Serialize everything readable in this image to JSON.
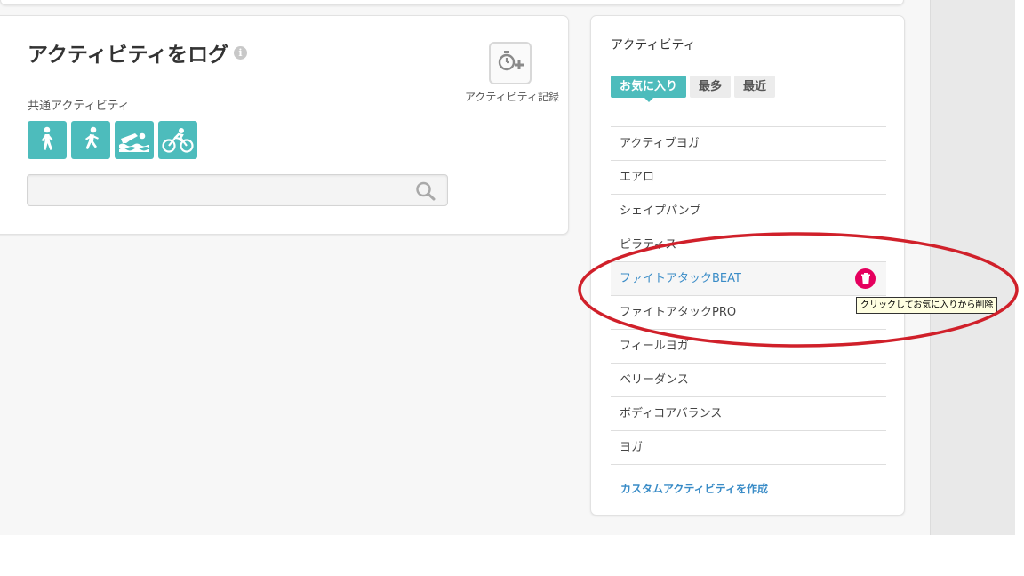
{
  "log": {
    "title": "アクティビティをログ",
    "info_icon": "info-icon",
    "common_label": "共通アクティビティ",
    "common_activities": [
      {
        "icon": "walk-icon"
      },
      {
        "icon": "run-icon"
      },
      {
        "icon": "swim-icon"
      },
      {
        "icon": "bike-icon"
      }
    ],
    "search": {
      "value": "",
      "placeholder": "",
      "icon": "search-icon"
    },
    "record": {
      "label": "アクティビティ記録",
      "icon": "stopwatch-plus-icon"
    }
  },
  "activities": {
    "title": "アクティビティ",
    "tabs": [
      {
        "label": "お気に入り",
        "active": true
      },
      {
        "label": "最多",
        "active": false
      },
      {
        "label": "最近",
        "active": false
      }
    ],
    "items": [
      {
        "label": "アクティブヨガ"
      },
      {
        "label": "エアロ"
      },
      {
        "label": "シェイプパンプ"
      },
      {
        "label": "ピラティス"
      },
      {
        "label": "ファイトアタックBEAT"
      },
      {
        "label": "ファイトアタックPRO"
      },
      {
        "label": "フィールヨガ"
      },
      {
        "label": "ベリーダンス"
      },
      {
        "label": "ボディコアバランス"
      },
      {
        "label": "ヨガ"
      }
    ],
    "hovered_index": 4,
    "delete_icon": "trash-icon",
    "tooltip": "クリックしてお気に入りから削除",
    "create_link": "カスタムアクティビティを作成"
  },
  "colors": {
    "accent_teal": "#4dbcbc",
    "link_blue": "#3a8cc7",
    "delete_pink": "#e5005e",
    "annotation_red": "#d0202a"
  }
}
